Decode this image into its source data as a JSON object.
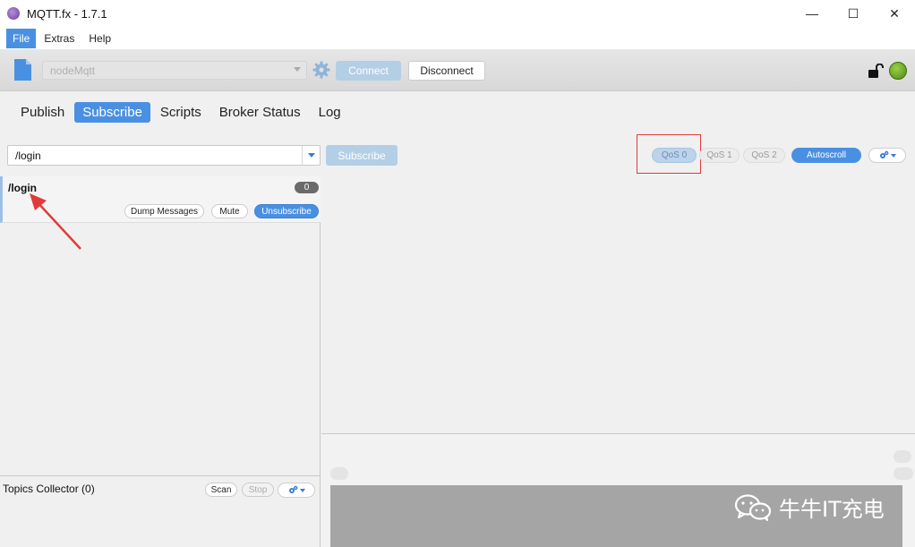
{
  "window": {
    "title": "MQTT.fx - 1.7.1",
    "minimize_glyph": "—",
    "maximize_glyph": "☐",
    "close_glyph": "✕"
  },
  "menu": {
    "items": [
      "File",
      "Extras",
      "Help"
    ],
    "active": "File"
  },
  "toolbar": {
    "profile": "nodeMqtt",
    "connect_label": "Connect",
    "disconnect_label": "Disconnect",
    "icons": [
      "document-icon",
      "gear-icon",
      "lock-open-icon",
      "connection-status-icon"
    ],
    "status_color": "#6fae22"
  },
  "tabs": [
    "Publish",
    "Subscribe",
    "Scripts",
    "Broker Status",
    "Log"
  ],
  "active_tab": "Subscribe",
  "subscribe_bar": {
    "topic_value": "/login",
    "subscribe_label": "Subscribe",
    "qos": [
      "QoS 0",
      "QoS 1",
      "QoS 2"
    ],
    "selected_qos": "QoS 0",
    "autoscroll_label": "Autoscroll"
  },
  "subscriptions": [
    {
      "topic": "/login",
      "count": "0",
      "dump_label": "Dump Messages",
      "mute_label": "Mute",
      "unsubscribe_label": "Unsubscribe"
    }
  ],
  "topics_collector": {
    "title": "Topics Collector (0)",
    "scan_label": "Scan",
    "stop_label": "Stop"
  },
  "watermark": {
    "text": "牛牛IT充电",
    "icon": "wechat-icon"
  },
  "colors": {
    "accent": "#4a90e2",
    "disabled": "#b3cfe6",
    "annotation": "#e23a3a"
  }
}
